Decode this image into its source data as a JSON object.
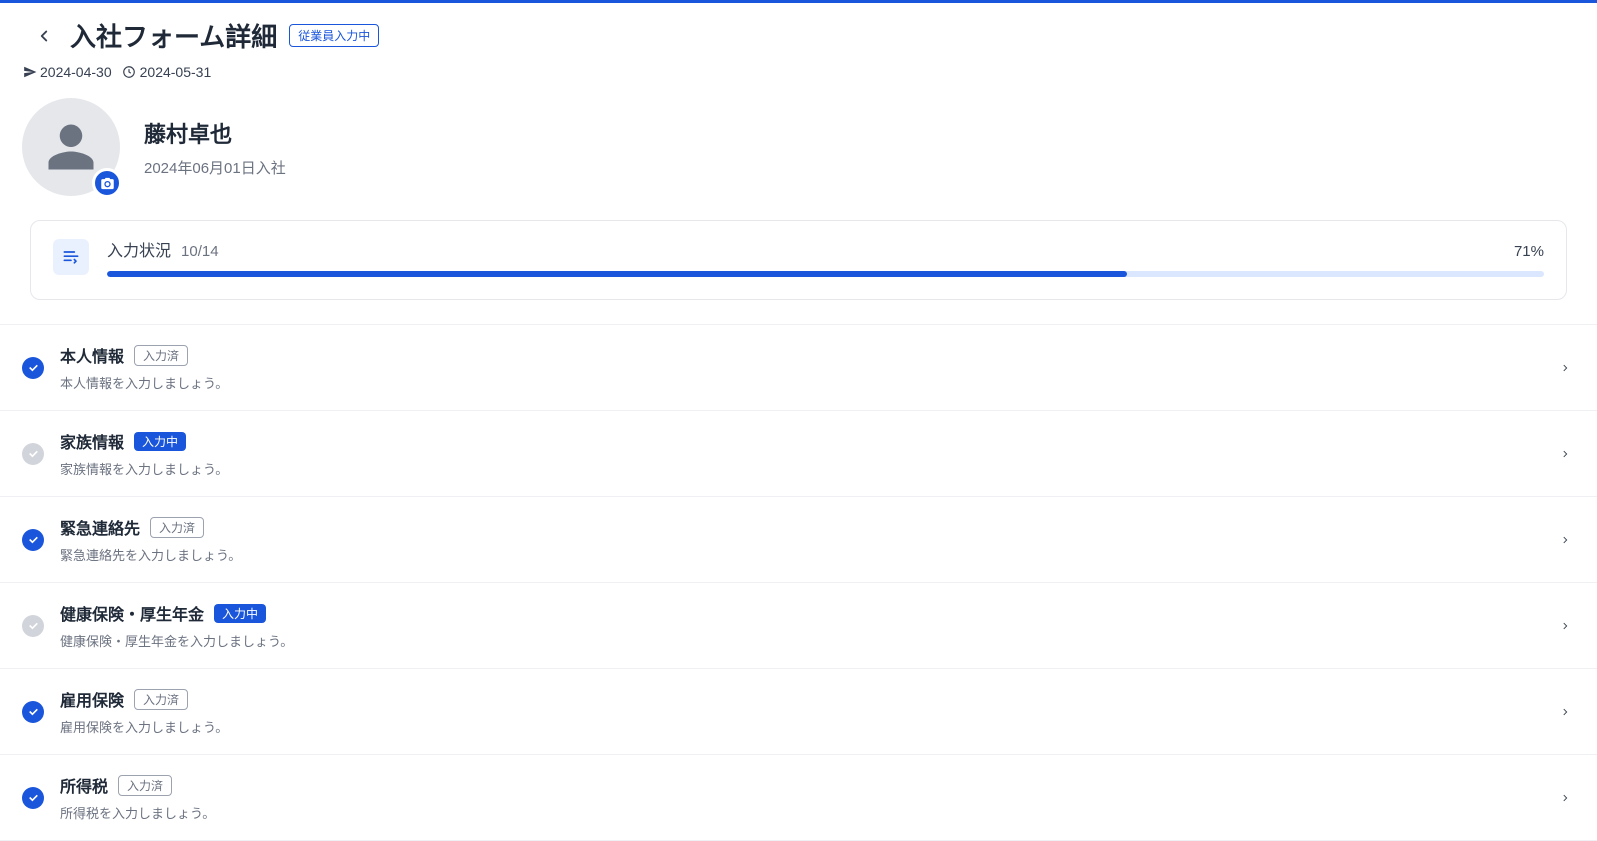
{
  "header": {
    "title": "入社フォーム詳細",
    "status_chip": "従業員入力中",
    "date1": "2024-04-30",
    "date2": "2024-05-31"
  },
  "profile": {
    "name": "藤村卓也",
    "subline": "2024年06月01日入社"
  },
  "progress": {
    "label": "入力状況",
    "count": "10/14",
    "percent_label": "71%",
    "percent_value": 71
  },
  "badges": {
    "done": "入力済",
    "in_progress": "入力中"
  },
  "sections": [
    {
      "title": "本人情報",
      "desc": "本人情報を入力しましょう。",
      "status": "done"
    },
    {
      "title": "家族情報",
      "desc": "家族情報を入力しましょう。",
      "status": "in_progress"
    },
    {
      "title": "緊急連絡先",
      "desc": "緊急連絡先を入力しましょう。",
      "status": "done"
    },
    {
      "title": "健康保険・厚生年金",
      "desc": "健康保険・厚生年金を入力しましょう。",
      "status": "in_progress"
    },
    {
      "title": "雇用保険",
      "desc": "雇用保険を入力しましょう。",
      "status": "done"
    },
    {
      "title": "所得税",
      "desc": "所得税を入力しましょう。",
      "status": "done"
    }
  ]
}
